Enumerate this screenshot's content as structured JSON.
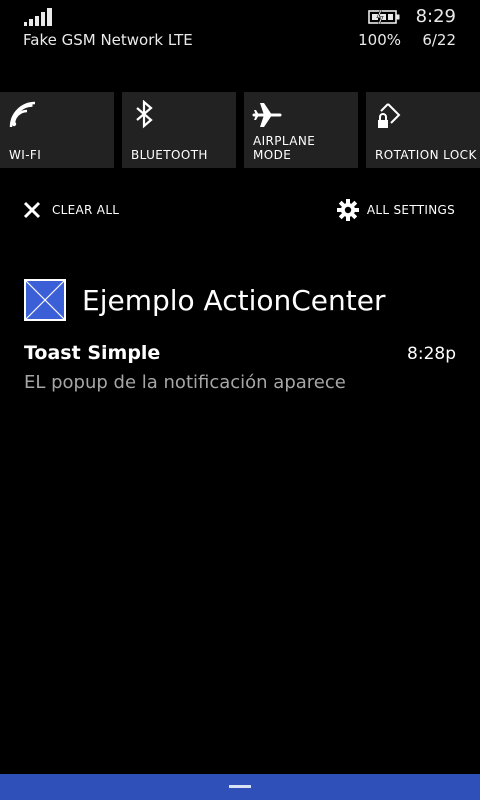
{
  "status_bar": {
    "carrier": "Fake GSM Network LTE",
    "time": "8:29",
    "battery_percent": "100%",
    "date": "6/22",
    "icons": [
      "signal-strength-icon",
      "battery-charging-icon"
    ]
  },
  "quick_actions": [
    {
      "label": "WI-FI",
      "icon": "wifi-icon"
    },
    {
      "label": "BLUETOOTH",
      "icon": "bluetooth-icon"
    },
    {
      "label": "AIRPLANE\nMODE",
      "icon": "airplane-icon"
    },
    {
      "label": "ROTATION LOCK",
      "icon": "rotation-lock-icon"
    }
  ],
  "actions": {
    "clear_all": "CLEAR ALL",
    "all_settings": "ALL SETTINGS"
  },
  "app_group": {
    "name": "Ejemplo ActionCenter",
    "icon": "app-placeholder-icon"
  },
  "notification": {
    "title": "Toast Simple",
    "time": "8:28p",
    "body": "EL popup de la notificación aparece"
  },
  "colors": {
    "background": "#000000",
    "tile": "#222222",
    "accent": "#2f50b8",
    "app_logo": "#3a5fd6"
  }
}
